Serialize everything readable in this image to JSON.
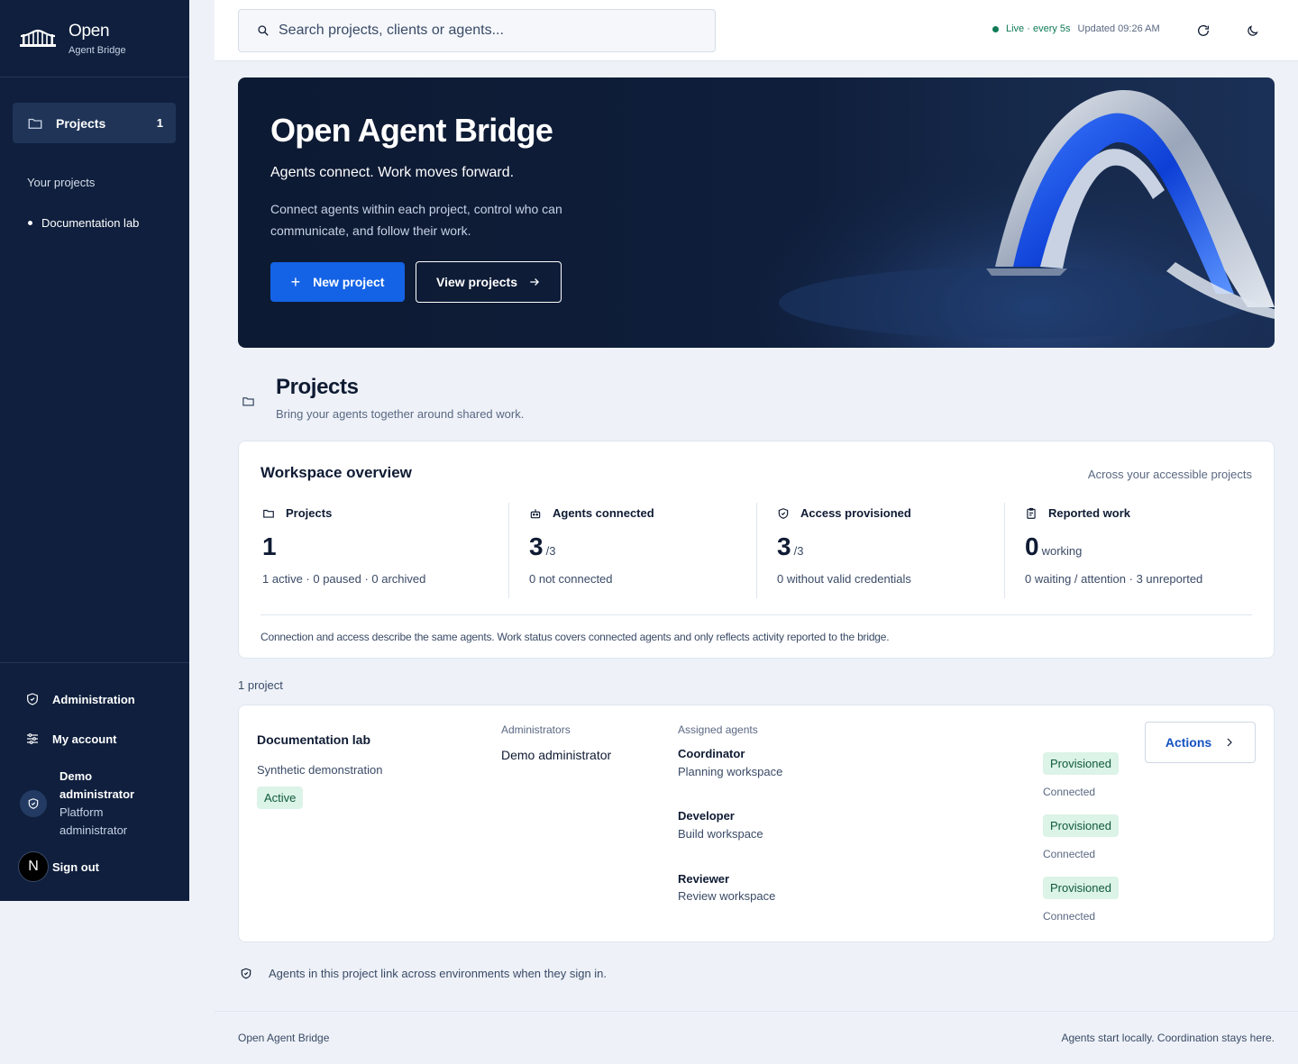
{
  "brand": {
    "title": "Open",
    "subtitle": "Agent Bridge"
  },
  "sidebar": {
    "nav": {
      "label": "Projects",
      "count": "1"
    },
    "section_heading": "Your projects",
    "projects": [
      "Documentation lab"
    ],
    "administration": "Administration",
    "my_account": "My account",
    "user": {
      "name": "Demo administrator",
      "role": "Platform administrator",
      "avatar_letter": "N"
    },
    "sign_out": "Sign out"
  },
  "topbar": {
    "search_placeholder": "Search projects, clients or agents...",
    "live": "Live · every 5s",
    "updated": "Updated 09:26 AM"
  },
  "hero": {
    "title": "Open Agent Bridge",
    "tagline": "Agents connect. Work moves forward.",
    "description": "Connect agents within each project, control who can communicate, and follow their work.",
    "primary_button": "New project",
    "secondary_button": "View projects"
  },
  "section": {
    "title": "Projects",
    "subtitle": "Bring your agents together around shared work."
  },
  "overview": {
    "title": "Workspace overview",
    "scope": "Across your accessible projects",
    "stats": [
      {
        "label": "Projects",
        "value": "1",
        "suffix": "",
        "note": "1 active · 0 paused · 0 archived"
      },
      {
        "label": "Agents connected",
        "value": "3",
        "suffix": "/3",
        "note": "0 not connected"
      },
      {
        "label": "Access provisioned",
        "value": "3",
        "suffix": "/3",
        "note": "0 without valid credentials"
      },
      {
        "label": "Reported work",
        "value": "0",
        "suffix": "working",
        "note": "0 waiting / attention · 3 unreported"
      }
    ],
    "footnote": "Connection and access describe the same agents. Work status covers connected agents and only reflects activity reported to the bridge."
  },
  "project_count": "1 project",
  "project": {
    "name": "Documentation lab",
    "description": "Synthetic demonstration",
    "status": "Active",
    "administrators_label": "Administrators",
    "administrator": "Demo administrator",
    "agents_label": "Assigned agents",
    "agents": [
      {
        "name": "Coordinator",
        "workspace": "Planning workspace",
        "access": "Provisioned",
        "connection": "Connected"
      },
      {
        "name": "Developer",
        "workspace": "Build workspace",
        "access": "Provisioned",
        "connection": "Connected"
      },
      {
        "name": "Reviewer",
        "workspace": "Review workspace",
        "access": "Provisioned",
        "connection": "Connected"
      }
    ],
    "actions": "Actions"
  },
  "hint": "Agents in this project link across environments when they sign in.",
  "footer": {
    "left": "Open Agent Bridge",
    "right": "Agents start locally. Coordination stays here."
  },
  "colors": {
    "sidebar": "#0f1f3d",
    "primary": "#1463e6",
    "success_bg": "#dcf3e7",
    "live": "#0f7a55"
  }
}
